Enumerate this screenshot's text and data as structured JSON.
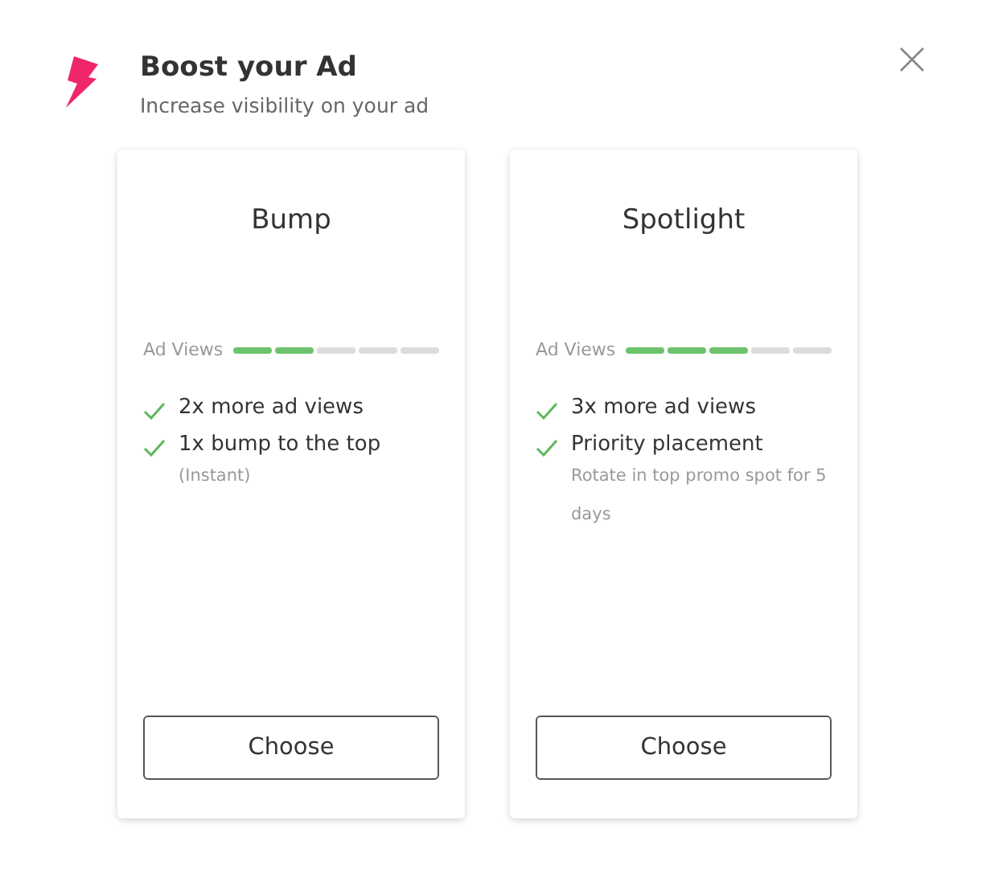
{
  "dialog": {
    "title": "Boost your Ad",
    "subtitle": "Increase visibility on your ad"
  },
  "plans": [
    {
      "name": "Bump",
      "meter_label": "Ad Views",
      "level": 0.4,
      "features": [
        {
          "text": "2x more ad views"
        },
        {
          "text": "1x bump to the top",
          "note": "(Instant)"
        }
      ],
      "button": "Choose"
    },
    {
      "name": "Spotlight",
      "meter_label": "Ad Views",
      "level": 0.6,
      "features": [
        {
          "text": "3x more ad views"
        },
        {
          "text": "Priority placement",
          "note": "Rotate in top promo spot for 5 days"
        }
      ],
      "button": "Choose"
    }
  ]
}
